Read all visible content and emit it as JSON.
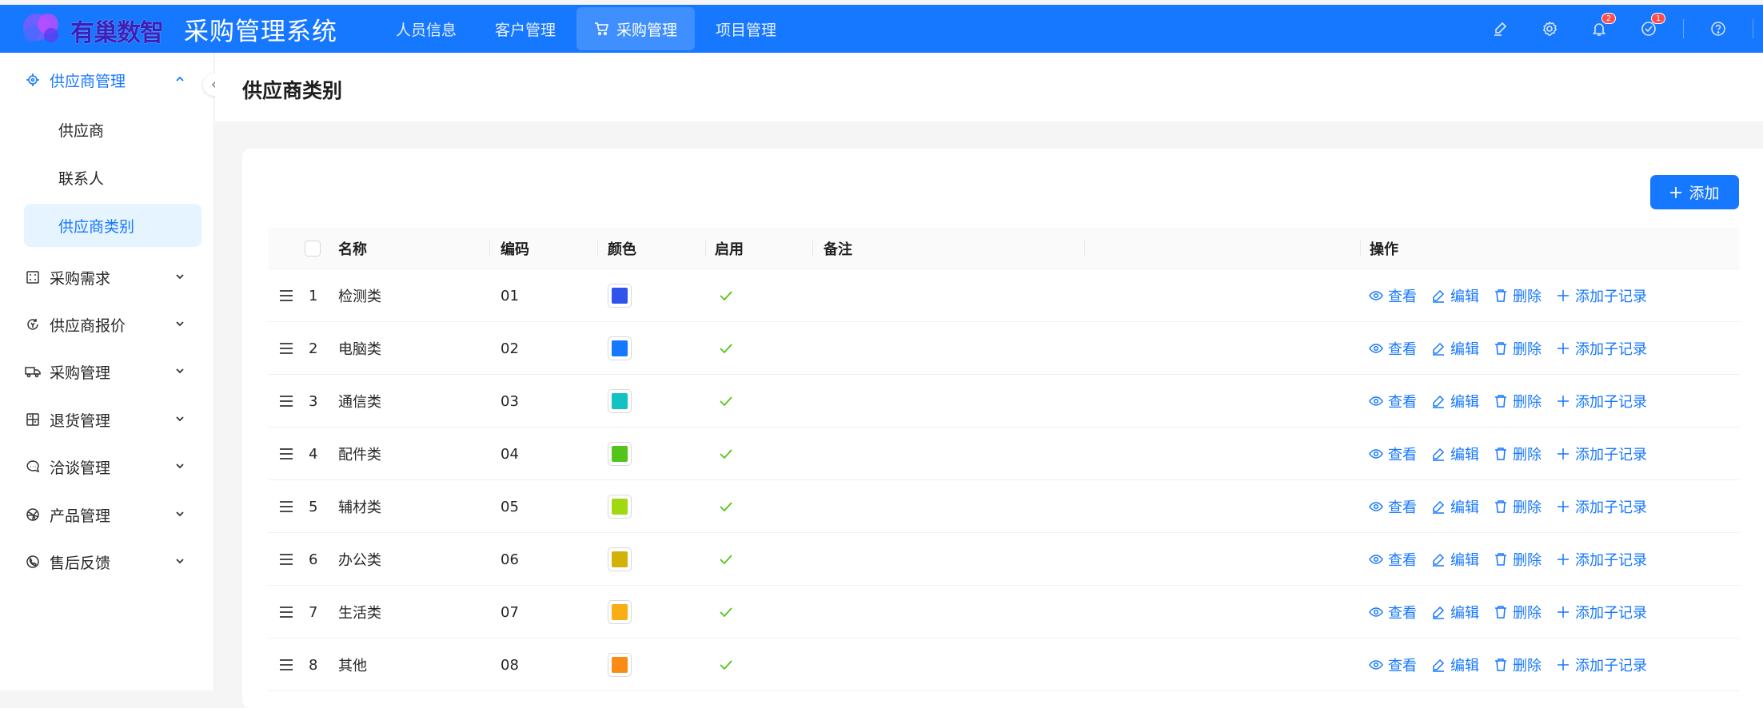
{
  "header": {
    "logo_text": "有巢数智",
    "app_title": "采购管理系统",
    "nav": [
      {
        "label": "人员信息"
      },
      {
        "label": "客户管理"
      },
      {
        "label": "采购管理",
        "active": true
      },
      {
        "label": "项目管理"
      }
    ],
    "notifications_count": "2",
    "todo_count": "1"
  },
  "sidebar": {
    "groups": [
      {
        "label": "供应商管理",
        "icon": "target-icon",
        "open": true
      },
      {
        "label": "采购需求",
        "icon": "grid-icon"
      },
      {
        "label": "供应商报价",
        "icon": "refresh-icon"
      },
      {
        "label": "采购管理",
        "icon": "truck-icon"
      },
      {
        "label": "退货管理",
        "icon": "return-icon"
      },
      {
        "label": "洽谈管理",
        "icon": "chat-icon"
      },
      {
        "label": "产品管理",
        "icon": "ball-icon"
      },
      {
        "label": "售后反馈",
        "icon": "phone-icon"
      }
    ],
    "sub_items": [
      {
        "label": "供应商"
      },
      {
        "label": "联系人"
      },
      {
        "label": "供应商类别",
        "active": true
      }
    ]
  },
  "page": {
    "title": "供应商类别",
    "add_label": "添加"
  },
  "table": {
    "columns": {
      "name": "名称",
      "code": "编码",
      "color": "颜色",
      "enabled": "启用",
      "remark": "备注",
      "actions": "操作"
    },
    "action_labels": {
      "view": "查看",
      "edit": "编辑",
      "delete": "删除",
      "add_child": "添加子记录"
    },
    "rows": [
      {
        "index": "1",
        "name": "检测类",
        "code": "01",
        "color": "#2f54eb",
        "enabled": true,
        "remark": ""
      },
      {
        "index": "2",
        "name": "电脑类",
        "code": "02",
        "color": "#1677ff",
        "enabled": true,
        "remark": ""
      },
      {
        "index": "3",
        "name": "通信类",
        "code": "03",
        "color": "#13c2c2",
        "enabled": true,
        "remark": ""
      },
      {
        "index": "4",
        "name": "配件类",
        "code": "04",
        "color": "#52c41a",
        "enabled": true,
        "remark": ""
      },
      {
        "index": "5",
        "name": "辅材类",
        "code": "05",
        "color": "#a0d911",
        "enabled": true,
        "remark": ""
      },
      {
        "index": "6",
        "name": "办公类",
        "code": "06",
        "color": "#d4b106",
        "enabled": true,
        "remark": ""
      },
      {
        "index": "7",
        "name": "生活类",
        "code": "07",
        "color": "#faad14",
        "enabled": true,
        "remark": ""
      },
      {
        "index": "8",
        "name": "其他",
        "code": "08",
        "color": "#fa8c16",
        "enabled": true,
        "remark": ""
      }
    ]
  },
  "colors": {
    "primary": "#1677ff",
    "enabled_check": "#52c41a",
    "badge": "#ff4d4f"
  }
}
